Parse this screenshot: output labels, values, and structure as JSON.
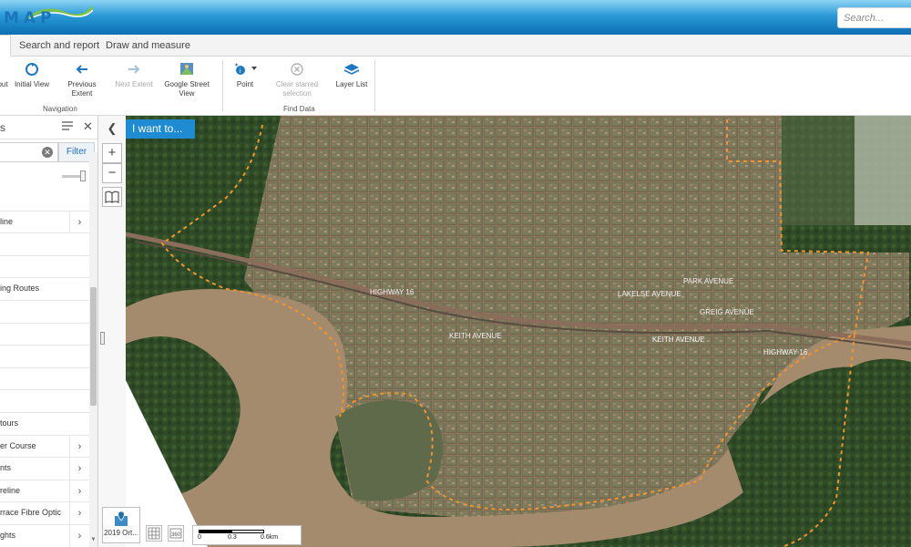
{
  "header": {
    "logo_text": "MAP",
    "search_placeholder": "Search..."
  },
  "tabs": [
    {
      "label": ""
    },
    {
      "label": "Search and report"
    },
    {
      "label": "Draw and measure"
    }
  ],
  "ribbon": {
    "navigation": {
      "label": "Navigation",
      "buttons": [
        {
          "label": "out"
        },
        {
          "label": "Initial View"
        },
        {
          "label": "Previous Extent"
        },
        {
          "label": "Next Extent"
        },
        {
          "label": "Google Street View"
        }
      ]
    },
    "find_data": {
      "label": "Find Data",
      "buttons": [
        {
          "label": "Point"
        },
        {
          "label": "Clear starred selection"
        },
        {
          "label": "Layer List"
        }
      ]
    }
  },
  "panel": {
    "title": "s",
    "filter_button": "Filter",
    "filter_value": "",
    "layers": [
      {
        "label": "",
        "has_children": false
      },
      {
        "label": "line",
        "has_children": true
      },
      {
        "label": "",
        "has_children": false
      },
      {
        "label": "",
        "has_children": false
      },
      {
        "label": "ing Routes",
        "has_children": false
      },
      {
        "label": "",
        "has_children": false
      },
      {
        "label": "",
        "has_children": false
      },
      {
        "label": "",
        "has_children": false
      },
      {
        "label": "",
        "has_children": false
      },
      {
        "label": "",
        "has_children": false
      },
      {
        "label": "tours",
        "has_children": false
      },
      {
        "label": "er Course",
        "has_children": true
      },
      {
        "label": "nts",
        "has_children": true
      },
      {
        "label": "reline",
        "has_children": true
      },
      {
        "label": "rrace Fibre Optic",
        "has_children": true
      },
      {
        "label": "ghts",
        "has_children": true
      }
    ],
    "opacity": 0.85
  },
  "map": {
    "i_want_to": "I want to...",
    "basemap_label": "2019 Ort...",
    "street_labels": [
      "HIGHWAY 16",
      "LAKELSE AVENUE",
      "GREIG AVENUE",
      "KEITH AVENUE",
      "KEITH AVENUE",
      "HIGHWAY 16",
      "PARK AVENUE"
    ],
    "scale_labels": [
      "0",
      "0.3",
      "0.6km"
    ],
    "colors": {
      "accent": "#1e8bd2",
      "boundary": "#f0942e",
      "river": "#a48b6d",
      "forest": "#2f4a26"
    }
  }
}
